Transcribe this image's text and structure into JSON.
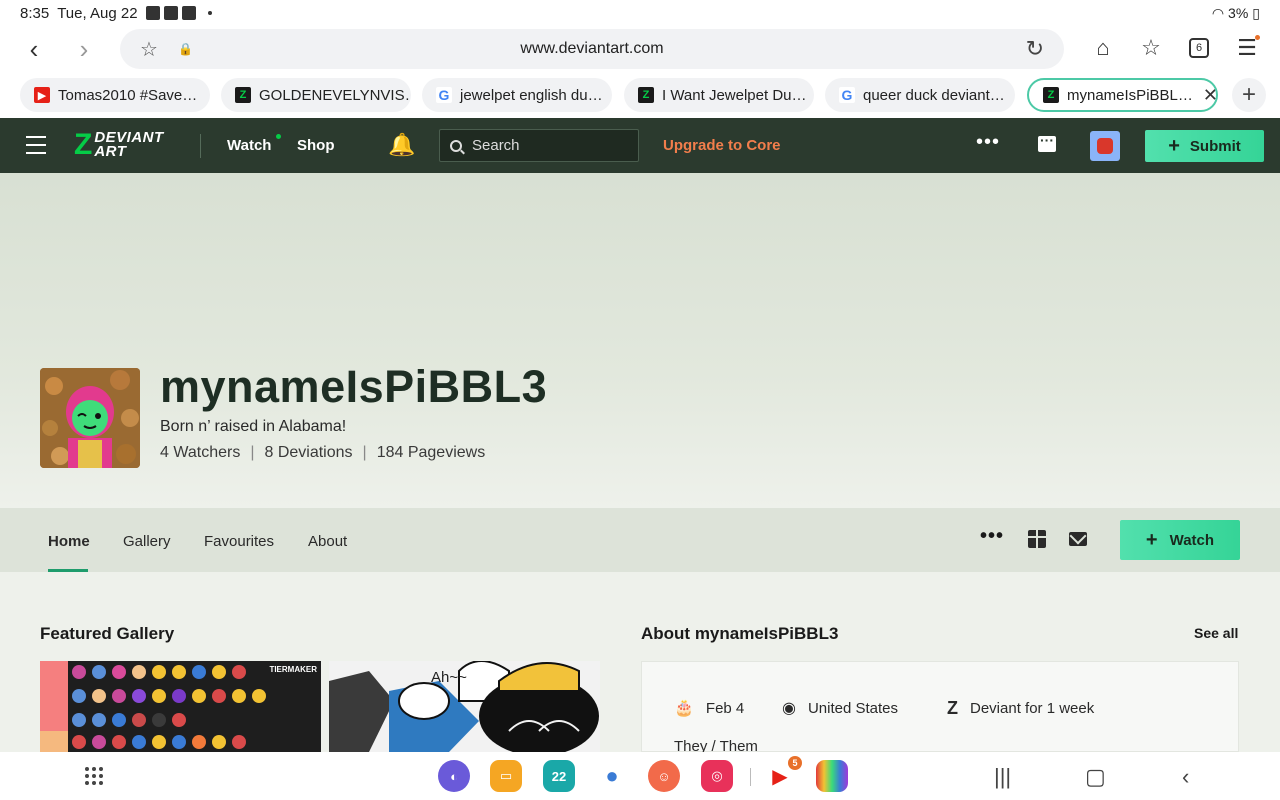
{
  "status_bar": {
    "time": "8:35",
    "date": "Tue, Aug 22",
    "battery": "3%"
  },
  "browser": {
    "url": "www.deviantart.com",
    "tab_count": "6",
    "tabs": [
      {
        "title": "Tomas2010 #Save…",
        "favicon": "youtube-icon"
      },
      {
        "title": "GOLDENEVELYNVIS…",
        "favicon": "deviantart-icon"
      },
      {
        "title": "jewelpet english du…",
        "favicon": "google-icon"
      },
      {
        "title": "I Want Jewelpet Du…",
        "favicon": "deviantart-icon"
      },
      {
        "title": "queer duck deviant…",
        "favicon": "google-icon"
      },
      {
        "title": "mynameIsPiBBL…",
        "favicon": "deviantart-icon",
        "active": true
      }
    ]
  },
  "header": {
    "logo_line1": "DEVIANT",
    "logo_line2": "ART",
    "watch": "Watch",
    "shop": "Shop",
    "search_placeholder": "Search",
    "upgrade": "Upgrade to Core",
    "submit": "Submit",
    "accent": "#05cc47"
  },
  "profile": {
    "username": "mynameIsPiBBL3",
    "tagline": "Born n’ raised in Alabama!",
    "watchers": "4 Watchers",
    "deviations": "8 Deviations",
    "pageviews": "184 Pageviews"
  },
  "profile_nav": {
    "items": [
      "Home",
      "Gallery",
      "Favourites",
      "About"
    ],
    "active": "Home",
    "watch_button": "Watch"
  },
  "featured": {
    "title": "Featured Gallery",
    "thumb1_caption": "TIERMAKER",
    "thumb2_caption": "Ah~~"
  },
  "about": {
    "title": "About mynameIsPiBBL3",
    "see_all": "See all",
    "birthday": "Feb 4",
    "location": "United States",
    "member_since": "Deviant for 1 week",
    "pronouns": "They / Them"
  },
  "dock": {
    "calendar_day": "22",
    "youtube_badge": "5"
  }
}
